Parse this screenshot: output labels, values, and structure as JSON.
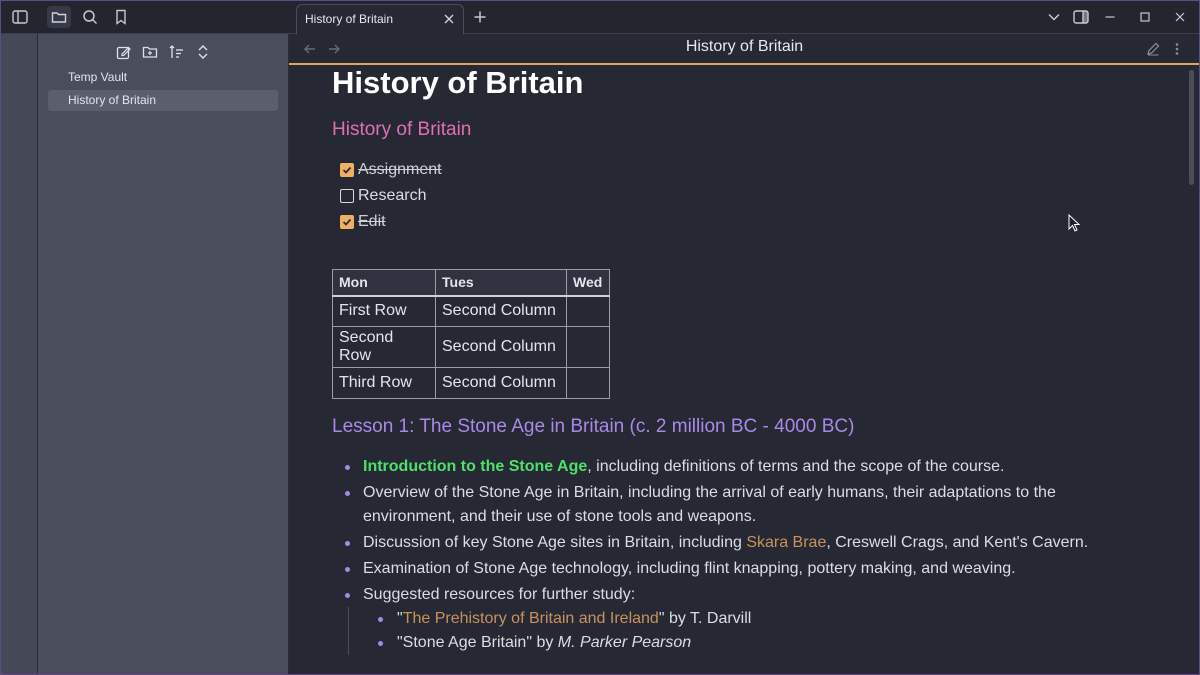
{
  "window": {
    "accent": "#e1a45e",
    "ribbon_color": "#454856",
    "sidebar_color": "#4a4d5c"
  },
  "left_toolbar": {
    "icons": [
      "sidebar-toggle-icon",
      "folder-icon",
      "search-icon",
      "bookmark-icon"
    ]
  },
  "sidebar": {
    "tools": [
      "new-note-icon",
      "new-folder-icon",
      "sort-icon",
      "collapse-icon"
    ],
    "items": [
      {
        "label": "Temp Vault",
        "selected": false
      },
      {
        "label": "History of Britain",
        "selected": true
      }
    ]
  },
  "tabs": {
    "active": {
      "label": "History of Britain"
    }
  },
  "nav": {
    "title": "History of Britain"
  },
  "note": {
    "title": "History of Britain",
    "heading2": "History of Britain",
    "tasks": [
      {
        "label": "Assignment",
        "done": true
      },
      {
        "label": "Research",
        "done": false
      },
      {
        "label": "Edit",
        "done": true
      }
    ],
    "table": {
      "headers": [
        "Mon",
        "Tues",
        "Wed"
      ],
      "rows": [
        [
          "First Row",
          "Second Column",
          ""
        ],
        [
          "Second Row",
          "Second Column",
          ""
        ],
        [
          "Third Row",
          "Second Column",
          ""
        ]
      ]
    },
    "lesson_heading": "Lesson 1: The Stone Age in Britain (c. 2 million BC - 4000 BC)",
    "bullets": {
      "b1_highlight": "Introduction to the Stone Age",
      "b1_rest": ", including definitions of terms and the scope of the course.",
      "b2": "Overview of the Stone Age in Britain, including the arrival of early humans, their adaptations to the environment, and their use of stone tools and weapons.",
      "b3_pre": "Discussion of key Stone Age sites in Britain, including ",
      "b3_link": "Skara Brae",
      "b3_post": ", Creswell Crags, and Kent's Cavern.",
      "b4": "Examination of Stone Age technology, including flint knapping, pottery making, and weaving.",
      "b5": "Suggested resources for further study:",
      "sub1_q1": "\"",
      "sub1_link": "The Prehistory of Britain and Ireland",
      "sub1_post": "\" by T. Darvill",
      "sub2_pre": "\"Stone Age Britain\" by ",
      "sub2_author": "M. Parker Pearson"
    }
  }
}
